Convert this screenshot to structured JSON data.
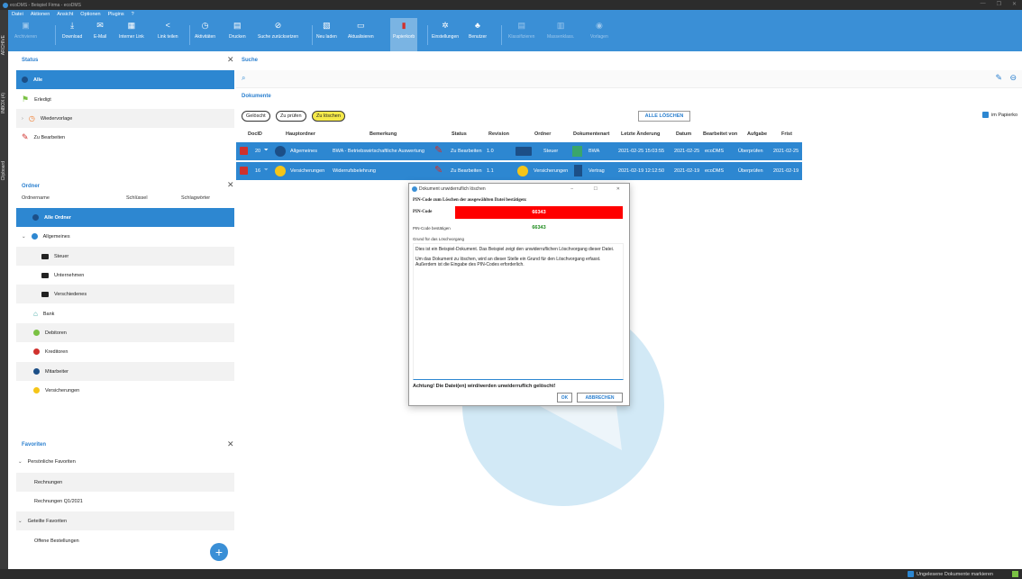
{
  "window": {
    "title": "ecoDMS - Beispiel Firma - ecoDMS",
    "controls": [
      "—",
      "❐",
      "✕"
    ]
  },
  "menu": [
    "Datei",
    "Aktionen",
    "Ansicht",
    "Optionen",
    "Plugins",
    "?"
  ],
  "toolbar": [
    {
      "label": "Archivieren",
      "icon": "archive-icon",
      "disabled": true
    },
    {
      "label": "Download",
      "icon": "download-icon"
    },
    {
      "label": "E-Mail",
      "icon": "mail-icon"
    },
    {
      "label": "Interner Link",
      "icon": "calendar-icon"
    },
    {
      "label": "Link teilen",
      "icon": "share-icon"
    },
    {
      "label": "Aktivitäten",
      "icon": "clock-icon"
    },
    {
      "label": "Drucken",
      "icon": "print-icon"
    },
    {
      "label": "Suche zurücksetzen",
      "icon": "reset-icon"
    },
    {
      "label": "Neu laden",
      "icon": "reload-icon"
    },
    {
      "label": "Aktualisieren",
      "icon": "update-icon"
    },
    {
      "label": "Papierkorb",
      "icon": "trash-icon",
      "active": true
    },
    {
      "label": "Einstellungen",
      "icon": "gear-icon"
    },
    {
      "label": "Benutzer",
      "icon": "users-icon"
    },
    {
      "label": "Klassifizieren",
      "icon": "classify-icon",
      "disabled": true
    },
    {
      "label": "Massenklass.",
      "icon": "mass-icon",
      "disabled": true
    },
    {
      "label": "Vorlagen",
      "icon": "template-icon",
      "disabled": true
    }
  ],
  "left_strip": [
    "ARCHIVE",
    "INBOX (4)",
    "Clipboard"
  ],
  "status_panel": {
    "title": "Status",
    "items": [
      {
        "label": "Alle",
        "selected": true
      },
      {
        "label": "Erledigt",
        "color": "#7ac143"
      },
      {
        "label": "Wiedervorlage",
        "color": "#f07a2b"
      },
      {
        "label": "Zu Bearbeiten",
        "color": "#d0312d"
      }
    ]
  },
  "folder_panel": {
    "title": "Ordner",
    "columns": [
      "Ordnername",
      "Schlüssel",
      "Schlagwörter"
    ],
    "items": [
      {
        "label": "Alle Ordner",
        "selected": true
      },
      {
        "label": "Allgemeines"
      },
      {
        "label": "Steuer"
      },
      {
        "label": "Unternehmen"
      },
      {
        "label": "Verschiedenes"
      },
      {
        "label": "Bank"
      },
      {
        "label": "Debitoren"
      },
      {
        "label": "Kreditoren"
      },
      {
        "label": "Mitarbeiter"
      },
      {
        "label": "Versicherungen"
      }
    ]
  },
  "favorites_panel": {
    "title": "Favoriten",
    "items": [
      {
        "label": "Persönliche Favoriten",
        "group": true
      },
      {
        "label": "Rechnungen"
      },
      {
        "label": "Rechnungen Q1/2021"
      },
      {
        "label": "Geteilte Favoriten",
        "group": true
      },
      {
        "label": "Offene Bestellungen"
      }
    ],
    "add_icon": "+"
  },
  "search_panel": {
    "title": "Suche",
    "search_icon": "⌕",
    "documents_title": "Dokumente",
    "filters": [
      {
        "label": "Gelöscht"
      },
      {
        "label": "Zu prüfen"
      },
      {
        "label": "Zu löschen",
        "active": true
      }
    ],
    "delete_all": "ALLE LÖSCHEN",
    "papierkorb_check": "im Papierko",
    "columns": [
      "DocID",
      "Hauptordner",
      "Bemerkung",
      "Status",
      "Revision",
      "Ordner",
      "Dokumentenart",
      "Letzte Änderung",
      "Datum",
      "Bearbeitet von",
      "Aufgabe",
      "Frist"
    ],
    "rows": [
      {
        "docid": "20",
        "hauptordner": "Allgemeines",
        "bemerkung": "BWA - Betriebswirtschaftliche Auswertung",
        "status": "Zu Bearbeiten",
        "revision": "1.0",
        "ordner": "Steuer",
        "dokumentenart": "BWA",
        "letzte": "2021-02-25 15:03:55",
        "datum": "2021-02-25",
        "bearbeitet": "ecoDMS",
        "aufgabe": "Überprüfen",
        "frist": "2021-02-25"
      },
      {
        "docid": "16",
        "hauptordner": "Versicherungen",
        "bemerkung": "Widerrufsbelehrung",
        "status": "Zu Bearbeiten",
        "revision": "1.1",
        "ordner": "Versicherungen",
        "dokumentenart": "Vertrag",
        "letzte": "2021-02-19 12:12:50",
        "datum": "2021-02-19",
        "bearbeitet": "ecoDMS",
        "aufgabe": "Überprüfen",
        "frist": "2021-02-19"
      }
    ]
  },
  "dialog": {
    "title": "Dokument unwiderruflich löschen",
    "heading": "PIN-Code zum Löschen der ausgewählten Datei bestätigen:",
    "pin_label": "PIN-Code",
    "pin_value": "66343",
    "confirm_label": "PIN-Code bestätigen",
    "confirm_value": "66343",
    "reason_label": "Grund für das Löschvorgang",
    "reason_p1": "Dies ist ein Beispiel-Dokument. Das Beispiel zeigt den unwiderruflichen Löschvorgang dieser Datei.",
    "reason_p2": "Um das Dokument zu löschen, wird an dieser Stelle ein Grund für den Löschvorgang erfasst. Außerdem ist die Eingabe des PIN-Codes erforderlich.",
    "warning": "Achtung! Die Datei(en) wird/werden unwiderruflich gelöscht!",
    "ok": "OK",
    "cancel": "ABBRECHEN"
  },
  "statusbar": {
    "unread": "Ungelesene Dokumente markieren"
  },
  "colors": {
    "accent": "#3a8fd6",
    "selection": "#2d87d1",
    "pin_bg": "#ff0000",
    "highlight": "#f5e94a"
  }
}
